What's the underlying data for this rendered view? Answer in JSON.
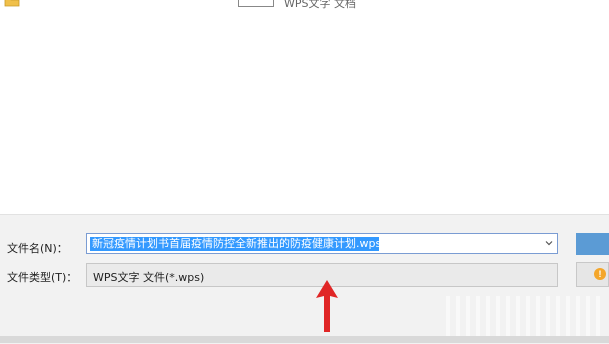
{
  "colors": {
    "accent": "#3399ff",
    "button": "#5b9bd5",
    "arrow": "#e02626",
    "shield": "#f4a62a"
  },
  "file_list": {
    "item_label": "WPS文字 文档",
    "item_icon": "document-icon"
  },
  "save_dialog": {
    "file_name_label": "文件名(N)：",
    "file_name_value": "新冠疫情计划书首届疫情防控全新推出的防疫健康计划.wps",
    "file_type_label": "文件类型(T)：",
    "file_type_value": "WPS文字 文件(*.wps)",
    "save_button": "",
    "cancel_button": "",
    "cancel_icon": "shield-icon",
    "dropdown_icon": "chevron-down-icon"
  },
  "annotation": {
    "icon": "red-arrow-icon"
  }
}
